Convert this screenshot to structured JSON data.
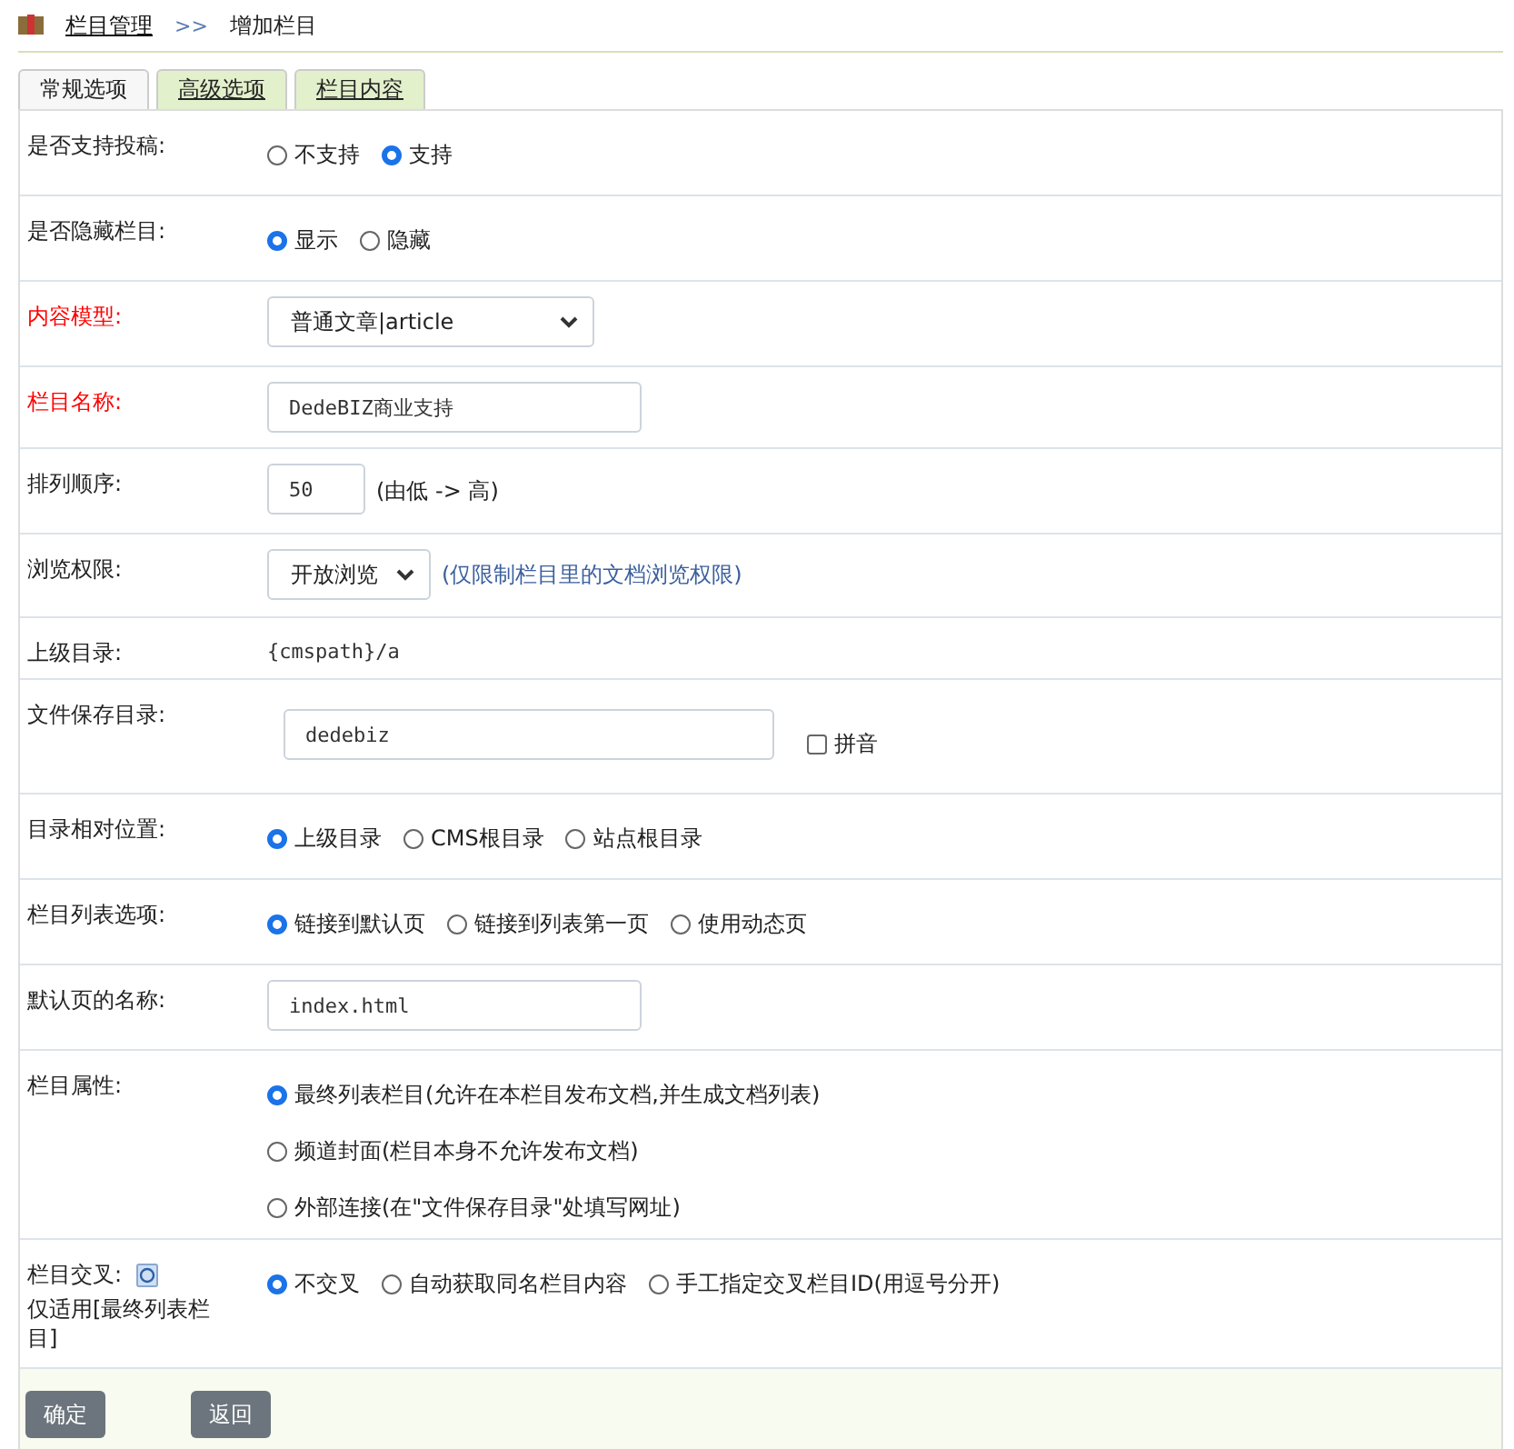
{
  "breadcrumb": {
    "link": "栏目管理",
    "separator": ">>",
    "current": "增加栏目"
  },
  "tabs": [
    {
      "label": "常规选项",
      "selected": true
    },
    {
      "label": "高级选项",
      "selected": false
    },
    {
      "label": "栏目内容",
      "selected": false
    }
  ],
  "rows": [
    {
      "kind": "radio",
      "label": "是否支持投稿:",
      "required": false,
      "options": [
        {
          "label": "不支持",
          "selected": false
        },
        {
          "label": "支持",
          "selected": true
        }
      ]
    },
    {
      "kind": "radio",
      "label": "是否隐藏栏目:",
      "required": false,
      "options": [
        {
          "label": "显示",
          "selected": true
        },
        {
          "label": "隐藏",
          "selected": false
        }
      ]
    },
    {
      "kind": "select",
      "label": "内容模型:",
      "required": true,
      "value": "普通文章|article"
    },
    {
      "kind": "input",
      "label": "栏目名称:",
      "required": true,
      "value": "DedeBIZ商业支持"
    },
    {
      "kind": "input",
      "label": "排列顺序:",
      "required": false,
      "value": "50",
      "note": "(由低 -> 高)"
    },
    {
      "kind": "select",
      "label": "浏览权限:",
      "required": false,
      "value": "开放浏览",
      "note": "(仅限制栏目里的文档浏览权限)"
    },
    {
      "kind": "text",
      "label": "上级目录:",
      "required": false,
      "value": "{cmspath}/a"
    },
    {
      "kind": "input",
      "label": "文件保存目录:",
      "required": false,
      "value": "dedebiz",
      "checkbox": {
        "label": "拼音",
        "checked": false
      }
    },
    {
      "kind": "radio",
      "label": "目录相对位置:",
      "required": false,
      "options": [
        {
          "label": "上级目录",
          "selected": true
        },
        {
          "label": "CMS根目录",
          "selected": false
        },
        {
          "label": "站点根目录",
          "selected": false
        }
      ]
    },
    {
      "kind": "radio",
      "label": "栏目列表选项:",
      "required": false,
      "options": [
        {
          "label": "链接到默认页",
          "selected": true
        },
        {
          "label": "链接到列表第一页",
          "selected": false
        },
        {
          "label": "使用动态页",
          "selected": false
        }
      ]
    },
    {
      "kind": "input",
      "label": "默认页的名称:",
      "required": false,
      "value": "index.html"
    },
    {
      "kind": "radio_vertical",
      "label": "栏目属性:",
      "required": false,
      "options": [
        {
          "label": "最终列表栏目(允许在本栏目发布文档,并生成文档列表)",
          "selected": true
        },
        {
          "label": "频道封面(栏目本身不允许发布文档)",
          "selected": false
        },
        {
          "label": "外部连接(在\"文件保存目录\"处填写网址)",
          "selected": false
        }
      ]
    },
    {
      "kind": "radio",
      "label": "栏目交叉:",
      "required": false,
      "help": true,
      "sublabel": "仅适用[最终列表栏目]",
      "options": [
        {
          "label": "不交叉",
          "selected": true
        },
        {
          "label": "自动获取同名栏目内容",
          "selected": false
        },
        {
          "label": "手工指定交叉栏目ID(用逗号分开)",
          "selected": false
        }
      ]
    }
  ],
  "buttons": [
    "确定",
    "返回"
  ]
}
